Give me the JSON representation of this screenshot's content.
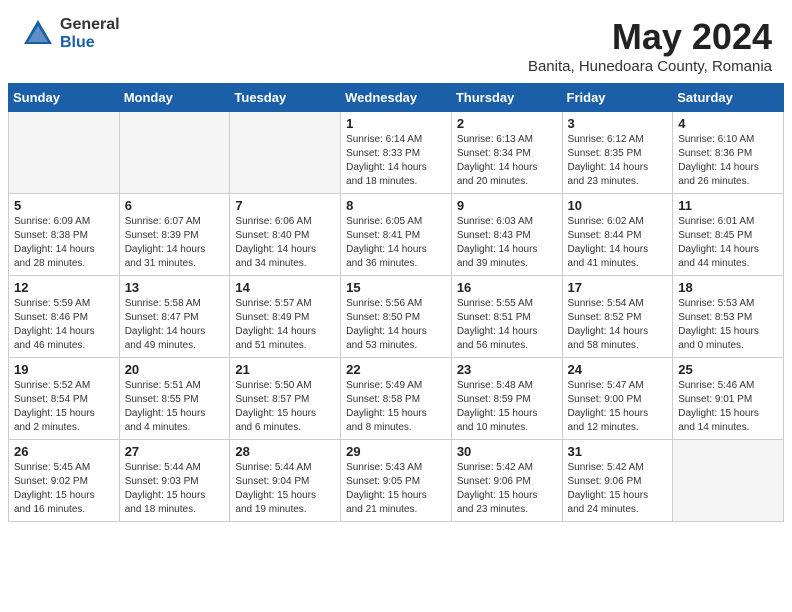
{
  "header": {
    "logo_general": "General",
    "logo_blue": "Blue",
    "month_year": "May 2024",
    "location": "Banita, Hunedoara County, Romania"
  },
  "weekdays": [
    "Sunday",
    "Monday",
    "Tuesday",
    "Wednesday",
    "Thursday",
    "Friday",
    "Saturday"
  ],
  "weeks": [
    [
      {
        "day": "",
        "info": ""
      },
      {
        "day": "",
        "info": ""
      },
      {
        "day": "",
        "info": ""
      },
      {
        "day": "1",
        "info": "Sunrise: 6:14 AM\nSunset: 8:33 PM\nDaylight: 14 hours\nand 18 minutes."
      },
      {
        "day": "2",
        "info": "Sunrise: 6:13 AM\nSunset: 8:34 PM\nDaylight: 14 hours\nand 20 minutes."
      },
      {
        "day": "3",
        "info": "Sunrise: 6:12 AM\nSunset: 8:35 PM\nDaylight: 14 hours\nand 23 minutes."
      },
      {
        "day": "4",
        "info": "Sunrise: 6:10 AM\nSunset: 8:36 PM\nDaylight: 14 hours\nand 26 minutes."
      }
    ],
    [
      {
        "day": "5",
        "info": "Sunrise: 6:09 AM\nSunset: 8:38 PM\nDaylight: 14 hours\nand 28 minutes."
      },
      {
        "day": "6",
        "info": "Sunrise: 6:07 AM\nSunset: 8:39 PM\nDaylight: 14 hours\nand 31 minutes."
      },
      {
        "day": "7",
        "info": "Sunrise: 6:06 AM\nSunset: 8:40 PM\nDaylight: 14 hours\nand 34 minutes."
      },
      {
        "day": "8",
        "info": "Sunrise: 6:05 AM\nSunset: 8:41 PM\nDaylight: 14 hours\nand 36 minutes."
      },
      {
        "day": "9",
        "info": "Sunrise: 6:03 AM\nSunset: 8:43 PM\nDaylight: 14 hours\nand 39 minutes."
      },
      {
        "day": "10",
        "info": "Sunrise: 6:02 AM\nSunset: 8:44 PM\nDaylight: 14 hours\nand 41 minutes."
      },
      {
        "day": "11",
        "info": "Sunrise: 6:01 AM\nSunset: 8:45 PM\nDaylight: 14 hours\nand 44 minutes."
      }
    ],
    [
      {
        "day": "12",
        "info": "Sunrise: 5:59 AM\nSunset: 8:46 PM\nDaylight: 14 hours\nand 46 minutes."
      },
      {
        "day": "13",
        "info": "Sunrise: 5:58 AM\nSunset: 8:47 PM\nDaylight: 14 hours\nand 49 minutes."
      },
      {
        "day": "14",
        "info": "Sunrise: 5:57 AM\nSunset: 8:49 PM\nDaylight: 14 hours\nand 51 minutes."
      },
      {
        "day": "15",
        "info": "Sunrise: 5:56 AM\nSunset: 8:50 PM\nDaylight: 14 hours\nand 53 minutes."
      },
      {
        "day": "16",
        "info": "Sunrise: 5:55 AM\nSunset: 8:51 PM\nDaylight: 14 hours\nand 56 minutes."
      },
      {
        "day": "17",
        "info": "Sunrise: 5:54 AM\nSunset: 8:52 PM\nDaylight: 14 hours\nand 58 minutes."
      },
      {
        "day": "18",
        "info": "Sunrise: 5:53 AM\nSunset: 8:53 PM\nDaylight: 15 hours\nand 0 minutes."
      }
    ],
    [
      {
        "day": "19",
        "info": "Sunrise: 5:52 AM\nSunset: 8:54 PM\nDaylight: 15 hours\nand 2 minutes."
      },
      {
        "day": "20",
        "info": "Sunrise: 5:51 AM\nSunset: 8:55 PM\nDaylight: 15 hours\nand 4 minutes."
      },
      {
        "day": "21",
        "info": "Sunrise: 5:50 AM\nSunset: 8:57 PM\nDaylight: 15 hours\nand 6 minutes."
      },
      {
        "day": "22",
        "info": "Sunrise: 5:49 AM\nSunset: 8:58 PM\nDaylight: 15 hours\nand 8 minutes."
      },
      {
        "day": "23",
        "info": "Sunrise: 5:48 AM\nSunset: 8:59 PM\nDaylight: 15 hours\nand 10 minutes."
      },
      {
        "day": "24",
        "info": "Sunrise: 5:47 AM\nSunset: 9:00 PM\nDaylight: 15 hours\nand 12 minutes."
      },
      {
        "day": "25",
        "info": "Sunrise: 5:46 AM\nSunset: 9:01 PM\nDaylight: 15 hours\nand 14 minutes."
      }
    ],
    [
      {
        "day": "26",
        "info": "Sunrise: 5:45 AM\nSunset: 9:02 PM\nDaylight: 15 hours\nand 16 minutes."
      },
      {
        "day": "27",
        "info": "Sunrise: 5:44 AM\nSunset: 9:03 PM\nDaylight: 15 hours\nand 18 minutes."
      },
      {
        "day": "28",
        "info": "Sunrise: 5:44 AM\nSunset: 9:04 PM\nDaylight: 15 hours\nand 19 minutes."
      },
      {
        "day": "29",
        "info": "Sunrise: 5:43 AM\nSunset: 9:05 PM\nDaylight: 15 hours\nand 21 minutes."
      },
      {
        "day": "30",
        "info": "Sunrise: 5:42 AM\nSunset: 9:06 PM\nDaylight: 15 hours\nand 23 minutes."
      },
      {
        "day": "31",
        "info": "Sunrise: 5:42 AM\nSunset: 9:06 PM\nDaylight: 15 hours\nand 24 minutes."
      },
      {
        "day": "",
        "info": ""
      }
    ]
  ]
}
